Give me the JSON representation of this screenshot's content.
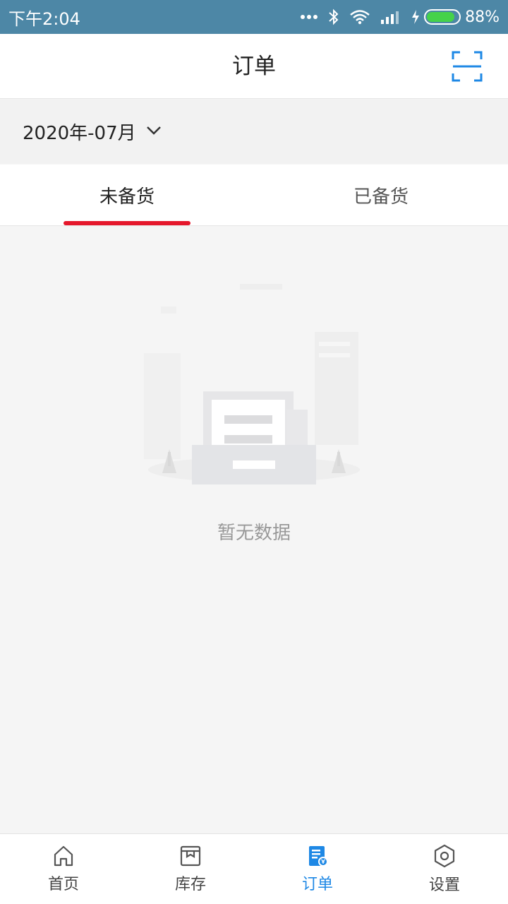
{
  "status": {
    "time": "下午2:04",
    "battery": "88%",
    "battery_level": 0.88,
    "colors": {
      "bar": "#4d87a6",
      "battery_fill": "#45d24a"
    }
  },
  "header": {
    "title": "订单",
    "scan_icon": "scan-icon",
    "accent": "#1e88e5"
  },
  "filter": {
    "date": "2020年-07月",
    "dropdown_icon": "chevron-down-icon"
  },
  "tabs": [
    {
      "label": "未备货",
      "active": true
    },
    {
      "label": "已备货",
      "active": false
    }
  ],
  "tab_indicator_color": "#e5172b",
  "empty": {
    "text": "暂无数据",
    "icon": "empty-document-illustration"
  },
  "bottom_nav": [
    {
      "label": "首页",
      "icon": "home-icon",
      "active": false
    },
    {
      "label": "库存",
      "icon": "inventory-box-icon",
      "active": false
    },
    {
      "label": "订单",
      "icon": "order-document-icon",
      "active": true
    },
    {
      "label": "设置",
      "icon": "gear-icon",
      "active": false
    }
  ]
}
